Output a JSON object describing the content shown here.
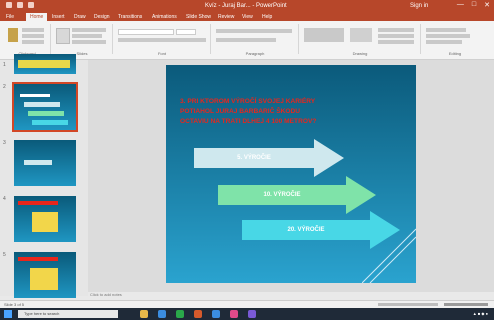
{
  "window": {
    "title": "Kvíz - Juraj Bar... - PowerPoint",
    "signin": "Sign in",
    "controls": [
      "—",
      "□",
      "✕"
    ]
  },
  "ribbon": {
    "tabs": [
      "File",
      "Home",
      "Insert",
      "Draw",
      "Design",
      "Transitions",
      "Animations",
      "Slide Show",
      "Review",
      "View",
      "Help"
    ],
    "active_tab": "Home",
    "groups": [
      "Clipboard",
      "Slides",
      "Font",
      "Paragraph",
      "Drawing",
      "Editing"
    ]
  },
  "slides_panel": {
    "numbers": [
      "1",
      "2",
      "3",
      "4",
      "5"
    ]
  },
  "slide": {
    "question": "3. PRI KTOROM VÝROČÍ SVOJEJ KARIÉRY\nPOTIAHOL JURAJ BARBARIČ ŠKODU\nOCTAVIU NA TRATI DLHEJ 4 100 METROV?",
    "answers": [
      "5. VÝROČIE",
      "10. VÝROČIE",
      "20. VÝROČIE"
    ],
    "answer_colors": [
      "#cfe8ee",
      "#7fe3a9",
      "#48d7e6"
    ],
    "question_color": "#e8261c"
  },
  "notes": "Click to add notes",
  "status": "Slide 3 of 5",
  "taskbar": {
    "search_placeholder": "Type here to search",
    "icon_colors": [
      "#e8b94a",
      "#3b8de0",
      "#2aa84a",
      "#d65a2c",
      "#3b8de0",
      "#e04a8a",
      "#7a5ad6"
    ]
  }
}
